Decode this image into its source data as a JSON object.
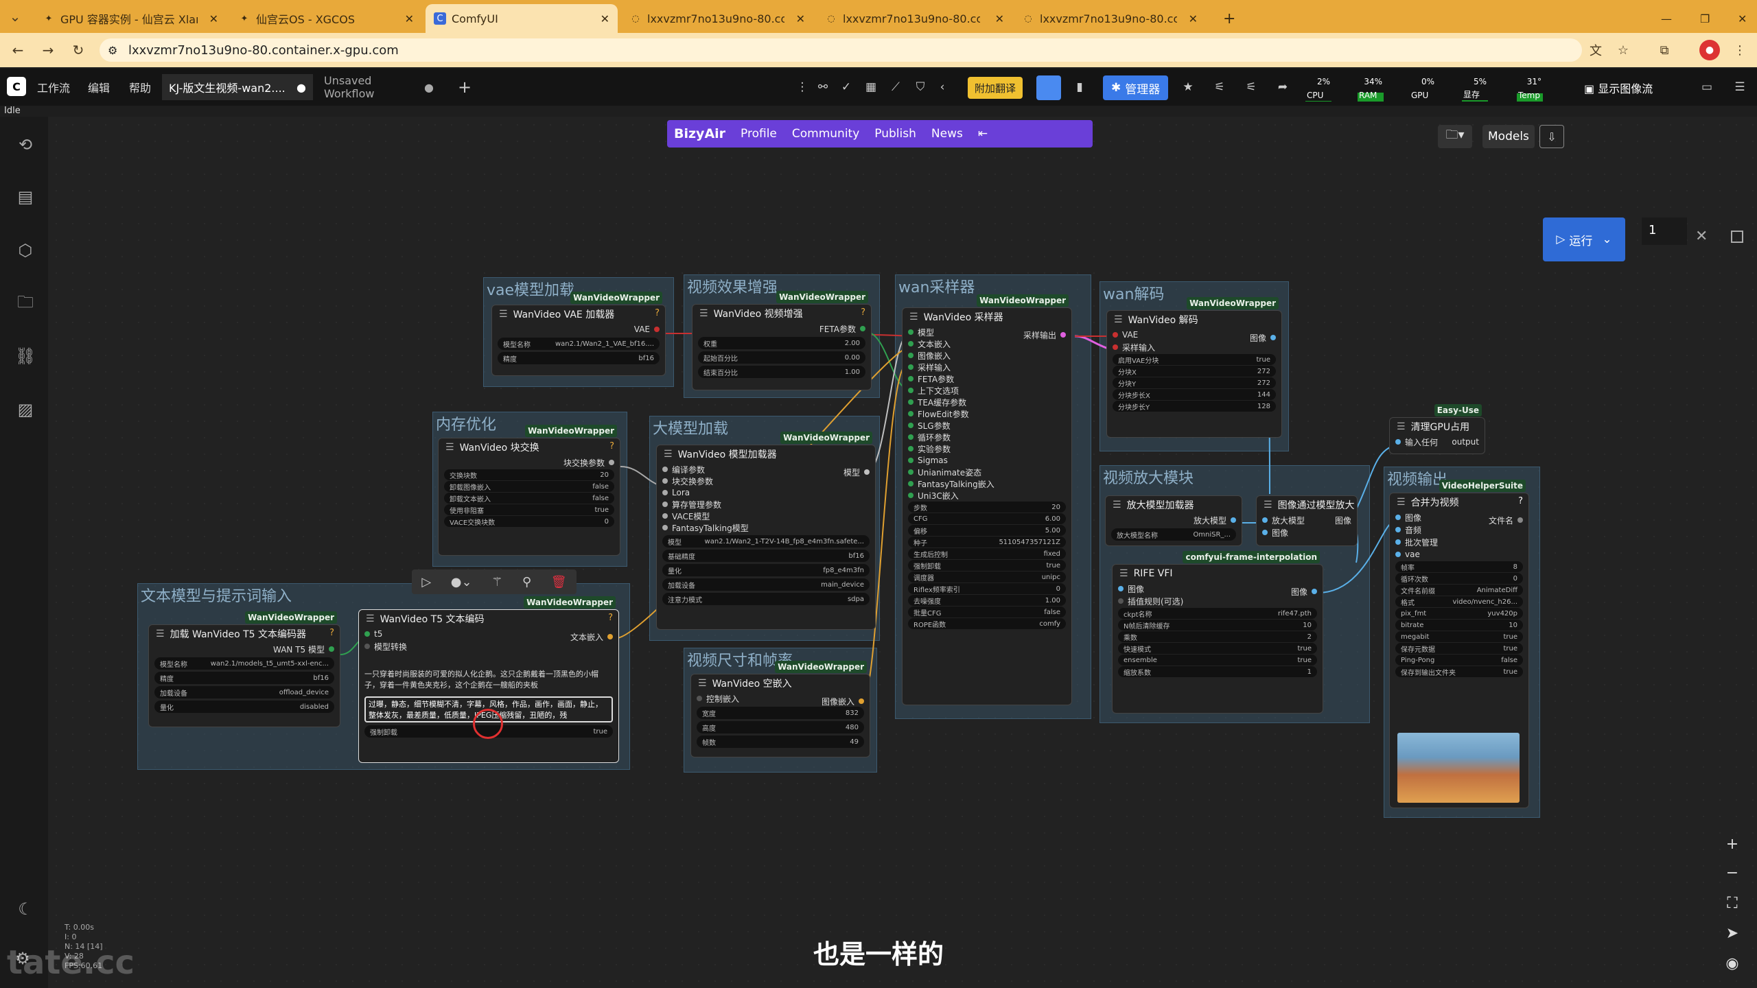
{
  "browser": {
    "tabs": [
      {
        "title": "GPU 容器实例 - 仙宫云 Xlangu",
        "active": false
      },
      {
        "title": "仙宫云OS - XGCOS",
        "active": false
      },
      {
        "title": "ComfyUI",
        "active": true
      },
      {
        "title": "lxxvzmr7no13u9no-80.contai",
        "active": false
      },
      {
        "title": "lxxvzmr7no13u9no-80.contai",
        "active": false
      },
      {
        "title": "lxxvzmr7no13u9no-80.contai",
        "active": false
      }
    ],
    "url": "lxxvzmr7no13u9no-80.container.x-gpu.com"
  },
  "menubar": {
    "items": [
      "工作流",
      "编辑",
      "帮助"
    ],
    "workflow_tabs": [
      {
        "label": "KJ-版文生视频-wan2....",
        "active": true
      },
      {
        "label": "Unsaved Workflow",
        "active": false
      }
    ],
    "translate_label": "附加翻译",
    "manager_label": "管理器",
    "monitors": [
      {
        "label": "CPU",
        "value": "2%",
        "level": 0.02
      },
      {
        "label": "RAM",
        "value": "34%",
        "level": 0.34
      },
      {
        "label": "GPU",
        "value": "0%",
        "level": 0.0
      },
      {
        "label": "显存",
        "value": "5%",
        "level": 0.05
      },
      {
        "label": "Temp",
        "value": "31°",
        "level": 0.31
      }
    ],
    "image_stream_label": "显示图像流",
    "status": "Idle"
  },
  "bizyair": {
    "logo": "BizyAir",
    "items": [
      "Profile",
      "Community",
      "Publish",
      "News"
    ]
  },
  "models_label": "Models",
  "run": {
    "label": "运行",
    "count": "1"
  },
  "subtitle": "也是一样的",
  "watermark": "tate.cc",
  "stats": [
    "T: 0.00s",
    "I: 0",
    "N: 14 [14]",
    "V: 28",
    "FPS:60.61"
  ],
  "groups": [
    {
      "title": "vae模型加载"
    },
    {
      "title": "视频效果增强"
    },
    {
      "title": "wan采样器"
    },
    {
      "title": "wan解码"
    },
    {
      "title": "内存优化"
    },
    {
      "title": "大模型加载"
    },
    {
      "title": "文本模型与提示词输入"
    },
    {
      "title": "视频尺寸和帧率"
    },
    {
      "title": "视频放大模块"
    },
    {
      "title": "视频输出"
    }
  ],
  "nodes": {
    "vae": {
      "badge": "WanVideoWrapper",
      "title": "WanVideo VAE 加载器",
      "out": "VAE",
      "widgets": [
        [
          "模型名称",
          "wan2.1/Wan2_1_VAE_bf16...."
        ],
        [
          "精度",
          "bf16"
        ]
      ]
    },
    "enhance": {
      "badge": "WanVideoWrapper",
      "title": "WanVideo 视频增强",
      "out": "FETA参数",
      "widgets": [
        [
          "权重",
          "2.00"
        ],
        [
          "起始百分比",
          "0.00"
        ],
        [
          "结束百分比",
          "1.00"
        ]
      ]
    },
    "sampler": {
      "badge": "WanVideoWrapper",
      "title": "WanVideo 采样器",
      "out": "采样输出",
      "inputs": [
        "模型",
        "文本嵌入",
        "图像嵌入",
        "采样输入",
        "FETA参数",
        "上下文选项",
        "TEA缓存参数",
        "FlowEdit参数",
        "SLG参数",
        "循环参数",
        "实验参数",
        "Sigmas",
        "Unianimate姿态",
        "FantasyTalking嵌入",
        "Uni3C嵌入"
      ],
      "widgets": [
        [
          "步数",
          "20"
        ],
        [
          "CFG",
          "6.00"
        ],
        [
          "偏移",
          "5.00"
        ],
        [
          "种子",
          "5110547357121Z"
        ],
        [
          "生成后控制",
          "fixed"
        ],
        [
          "强制卸载",
          "true"
        ],
        [
          "调度器",
          "unipc"
        ],
        [
          "Riflex频率索引",
          "0"
        ],
        [
          "去噪强度",
          "1.00"
        ],
        [
          "批量CFG",
          "false"
        ],
        [
          "ROPE函数",
          "comfy"
        ]
      ]
    },
    "decode": {
      "badge": "WanVideoWrapper",
      "title": "WanVideo 解码",
      "out": "图像",
      "inputs": [
        "VAE",
        "采样输入"
      ],
      "widgets": [
        [
          "启用VAE分块",
          "true"
        ],
        [
          "分块X",
          "272"
        ],
        [
          "分块Y",
          "272"
        ],
        [
          "分块步长X",
          "144"
        ],
        [
          "分块步长Y",
          "128"
        ]
      ]
    },
    "blockswap": {
      "badge": "WanVideoWrapper",
      "title": "WanVideo 块交换",
      "out": "块交换参数",
      "widgets": [
        [
          "交换块数",
          "20"
        ],
        [
          "卸载图像嵌入",
          "false"
        ],
        [
          "卸载文本嵌入",
          "false"
        ],
        [
          "使用非阻塞",
          "true"
        ],
        [
          "VACE交换块数",
          "0"
        ]
      ]
    },
    "modelloader": {
      "badge": "WanVideoWrapper",
      "title": "WanVideo 模型加载器",
      "out": "模型",
      "inputs": [
        "编译参数",
        "块交换参数",
        "Lora",
        "算存管理参数",
        "VACE模型",
        "FantasyTalking模型"
      ],
      "widgets": [
        [
          "模型",
          "wan2.1/Wan2_1-T2V-14B_fp8_e4m3fn.safete..."
        ],
        [
          "基础精度",
          "bf16"
        ],
        [
          "量化",
          "fp8_e4m3fn"
        ],
        [
          "加载设备",
          "main_device"
        ],
        [
          "注意力模式",
          "sdpa"
        ]
      ]
    },
    "t5loader": {
      "badge": "WanVideoWrapper",
      "title": "加载 WanVideo T5 文本编码器",
      "out": "WAN T5 模型",
      "widgets": [
        [
          "模型名称",
          "wan2.1/models_t5_umt5-xxl-enc..."
        ],
        [
          "精度",
          "bf16"
        ],
        [
          "加载设备",
          "offload_device"
        ],
        [
          "量化",
          "disabled"
        ]
      ]
    },
    "t5encode": {
      "badge": "WanVideoWrapper",
      "title": "WanVideo T5 文本编码",
      "out": "文本嵌入",
      "inputs": [
        "t5",
        "模型转换"
      ],
      "positive": "一只穿着时尚服装的可爱的拟人化企鹅。这只企鹅戴着一顶黑色的小帽子，穿着一件黄色夹克衫，这个企鹅在一艘船的夹板",
      "negative": "过曝，静态，细节模糊不清，字幕，风格，作品，画作，画面，静止，整体发灰，最差质量，低质量，JPEG压缩残留，丑陋的，残",
      "widgets": [
        [
          "强制卸载",
          "true"
        ]
      ]
    },
    "emptyembed": {
      "badge": "WanVideoWrapper",
      "title": "WanVideo 空嵌入",
      "out": "图像嵌入",
      "inputs": [
        "控制嵌入"
      ],
      "widgets": [
        [
          "宽度",
          "832"
        ],
        [
          "高度",
          "480"
        ],
        [
          "帧数",
          "49"
        ]
      ]
    },
    "upscaleloader": {
      "title": "放大模型加载器",
      "out": "放大模型",
      "widgets": [
        [
          "放大模型名称",
          "OmniSR_..."
        ]
      ]
    },
    "upscale": {
      "title": "图像通过模型放大",
      "out": "图像",
      "inputs": [
        "放大模型",
        "图像"
      ]
    },
    "rife": {
      "badge": "comfyui-frame-interpolation",
      "title": "RIFE VFI",
      "out": "图像",
      "inputs": [
        "图像",
        "插值规则(可选)"
      ],
      "widgets": [
        [
          "ckpt名称",
          "rife47.pth"
        ],
        [
          "N帧后清除缓存",
          "10"
        ],
        [
          "乘数",
          "2"
        ],
        [
          "快速模式",
          "true"
        ],
        [
          "ensemble",
          "true"
        ],
        [
          "缩放系数",
          "1"
        ]
      ]
    },
    "cleargpu": {
      "badge": "Easy-Use",
      "title": "清理GPU占用",
      "in": "输入任何",
      "out": "output"
    },
    "combine": {
      "badge": "VideoHelperSuite",
      "title": "合并为视频",
      "out": "文件名",
      "inputs": [
        "图像",
        "音频",
        "批次管理",
        "vae"
      ],
      "widgets": [
        [
          "帧率",
          "8"
        ],
        [
          "循环次数",
          "0"
        ],
        [
          "文件名前缀",
          "AnimateDiff"
        ],
        [
          "格式",
          "video/nvenc_h26..."
        ],
        [
          "pix_fmt",
          "yuv420p"
        ],
        [
          "bitrate",
          "10"
        ],
        [
          "megabit",
          "true"
        ],
        [
          "保存元数据",
          "true"
        ],
        [
          "Ping-Pong",
          "false"
        ],
        [
          "保存到输出文件夹",
          "true"
        ]
      ]
    }
  }
}
